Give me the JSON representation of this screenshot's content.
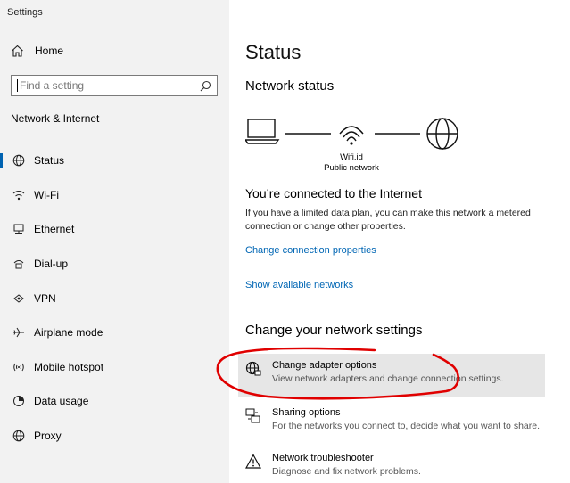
{
  "app": {
    "title": "Settings"
  },
  "sidebar": {
    "home_label": "Home",
    "search": {
      "placeholder": "Find a setting"
    },
    "section_title": "Network & Internet",
    "items": [
      {
        "label": "Status",
        "icon": "globe-icon",
        "active": true
      },
      {
        "label": "Wi-Fi",
        "icon": "wifi-icon"
      },
      {
        "label": "Ethernet",
        "icon": "ethernet-icon"
      },
      {
        "label": "Dial-up",
        "icon": "dialup-icon"
      },
      {
        "label": "VPN",
        "icon": "vpn-icon"
      },
      {
        "label": "Airplane mode",
        "icon": "airplane-icon"
      },
      {
        "label": "Mobile hotspot",
        "icon": "hotspot-icon"
      },
      {
        "label": "Data usage",
        "icon": "data-usage-icon"
      },
      {
        "label": "Proxy",
        "icon": "globe-icon"
      }
    ]
  },
  "main": {
    "title": "Status",
    "network_status_heading": "Network status",
    "network": {
      "name": "Wifi.id",
      "type": "Public network"
    },
    "connected_heading": "You’re connected to the Internet",
    "connected_desc": "If you have a limited data plan, you can make this network a metered connection or change other properties.",
    "link_change_properties": "Change connection properties",
    "link_show_networks": "Show available networks",
    "change_heading": "Change your network settings",
    "options": [
      {
        "name": "Change adapter options",
        "desc": "View network adapters and change connection settings.",
        "icon": "adapter-globe-icon"
      },
      {
        "name": "Sharing options",
        "desc": "For the networks you connect to, decide what you want to share.",
        "icon": "sharing-icon"
      },
      {
        "name": "Network troubleshooter",
        "desc": "Diagnose and fix network problems.",
        "icon": "warning-icon"
      }
    ]
  },
  "colors": {
    "accent": "#0063b1",
    "link": "#0066b4",
    "annotation": "#e00000",
    "sidebar_bg": "#f2f2f2"
  }
}
